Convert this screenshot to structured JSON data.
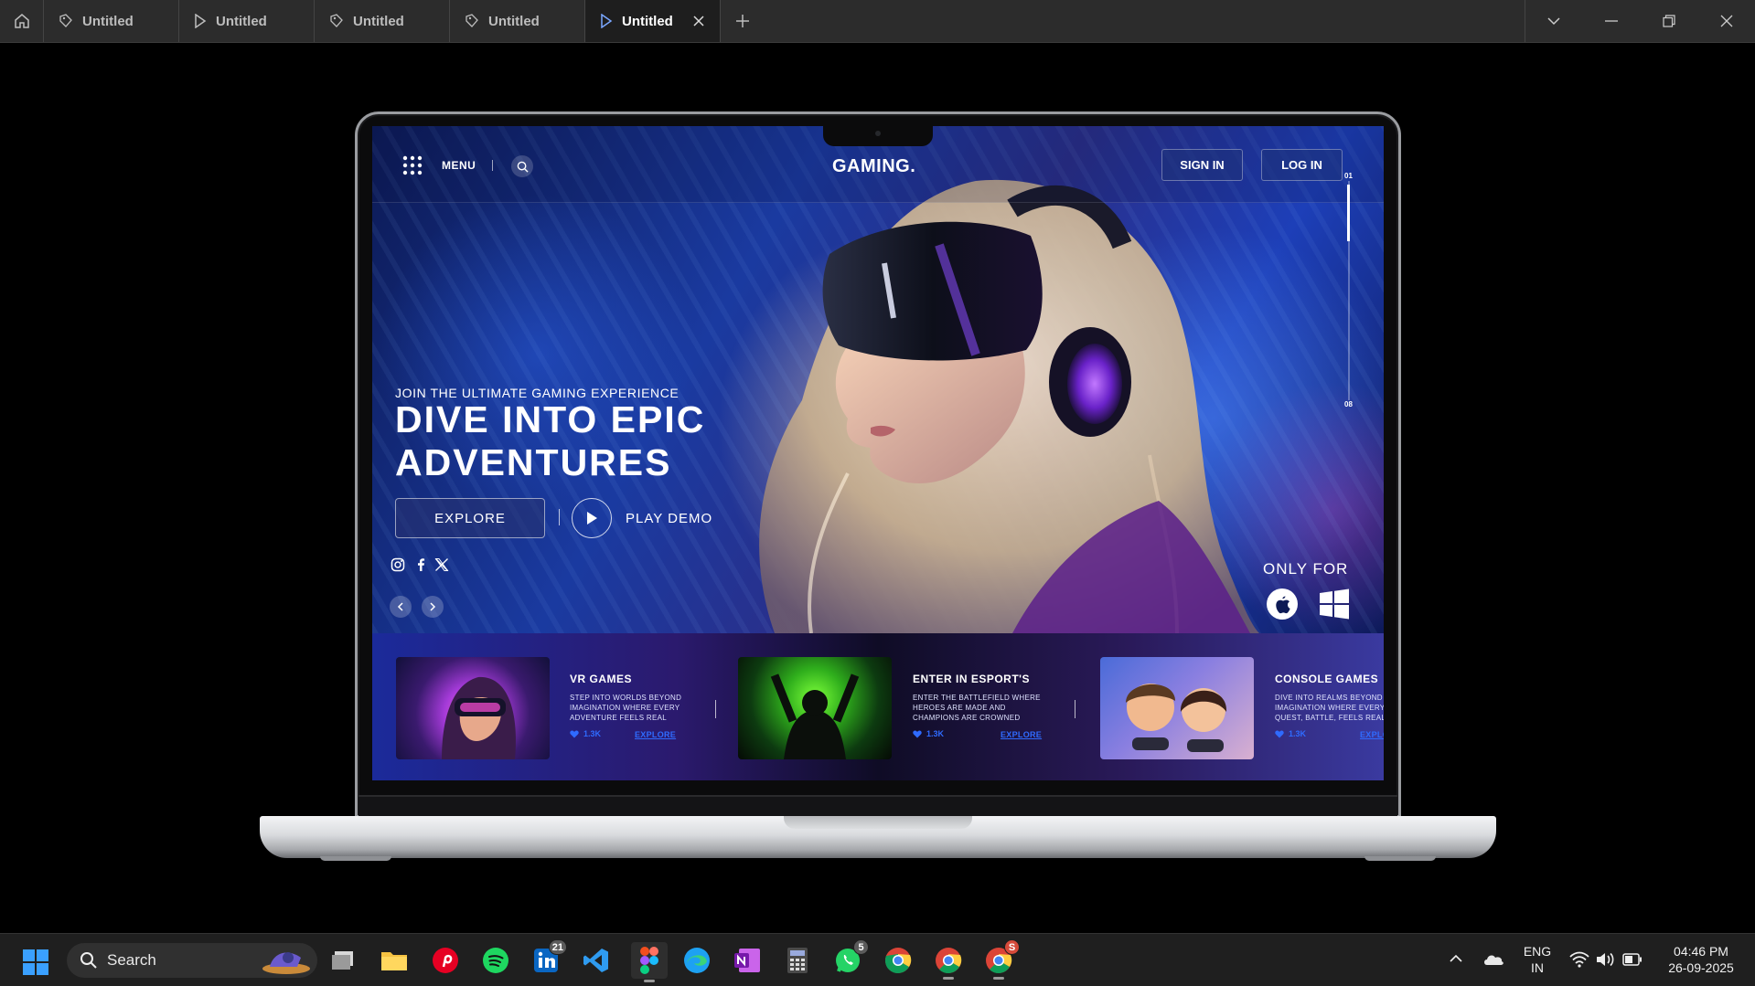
{
  "app": {
    "tabs": [
      {
        "label": "Untitled",
        "icon": "prototype-tag-icon"
      },
      {
        "label": "Untitled",
        "icon": "play-outline-icon"
      },
      {
        "label": "Untitled",
        "icon": "prototype-tag-icon"
      },
      {
        "label": "Untitled",
        "icon": "prototype-tag-icon"
      },
      {
        "label": "Untitled",
        "icon": "play-outline-icon",
        "active": true
      }
    ]
  },
  "site": {
    "nav": {
      "menu_label": "MENU",
      "logo": "GAMING.",
      "sign_in": "SIGN IN",
      "log_in": "LOG IN"
    },
    "hero": {
      "kicker": "JOIN THE ULTIMATE GAMING EXPERIENCE",
      "headline_1": "DIVE INTO EPIC",
      "headline_2": "ADVENTURES",
      "explore": "EXPLORE",
      "play_demo": "PLAY DEMO",
      "only_for": "ONLY FOR",
      "slide_current": "01",
      "slide_total": "08",
      "slide_progress": 0.26
    },
    "cards": [
      {
        "title": "VR GAMES",
        "desc": "STEP INTO WORLDS BEYOND IMAGINATION WHERE EVERY ADVENTURE FEELS REAL",
        "likes": "1.3K",
        "link": "EXPLORE"
      },
      {
        "title": "ENTER IN ESPORT'S",
        "desc": "ENTER THE BATTLEFIELD WHERE HEROES ARE MADE AND CHAMPIONS ARE CROWNED",
        "likes": "1.3K",
        "link": "EXPLORE"
      },
      {
        "title": "CONSOLE GAMES",
        "desc": "DIVE INTO REALMS BEYOND IMAGINATION WHERE EVERY QUEST, BATTLE, FEELS REAL",
        "likes": "1.3K",
        "link": "EXPLORE"
      }
    ]
  },
  "taskbar": {
    "search_label": "Search",
    "linkedin_badge": "21",
    "whatsapp_badge": "5",
    "chrome_badge": "S",
    "lang_1": "ENG",
    "lang_2": "IN",
    "time": "04:46 PM",
    "date": "26-09-2025"
  },
  "colors": {
    "accent_blue": "#2f6bff",
    "tabbar_bg": "#2c2c2c",
    "taskbar_bg": "#1f1f1f"
  }
}
